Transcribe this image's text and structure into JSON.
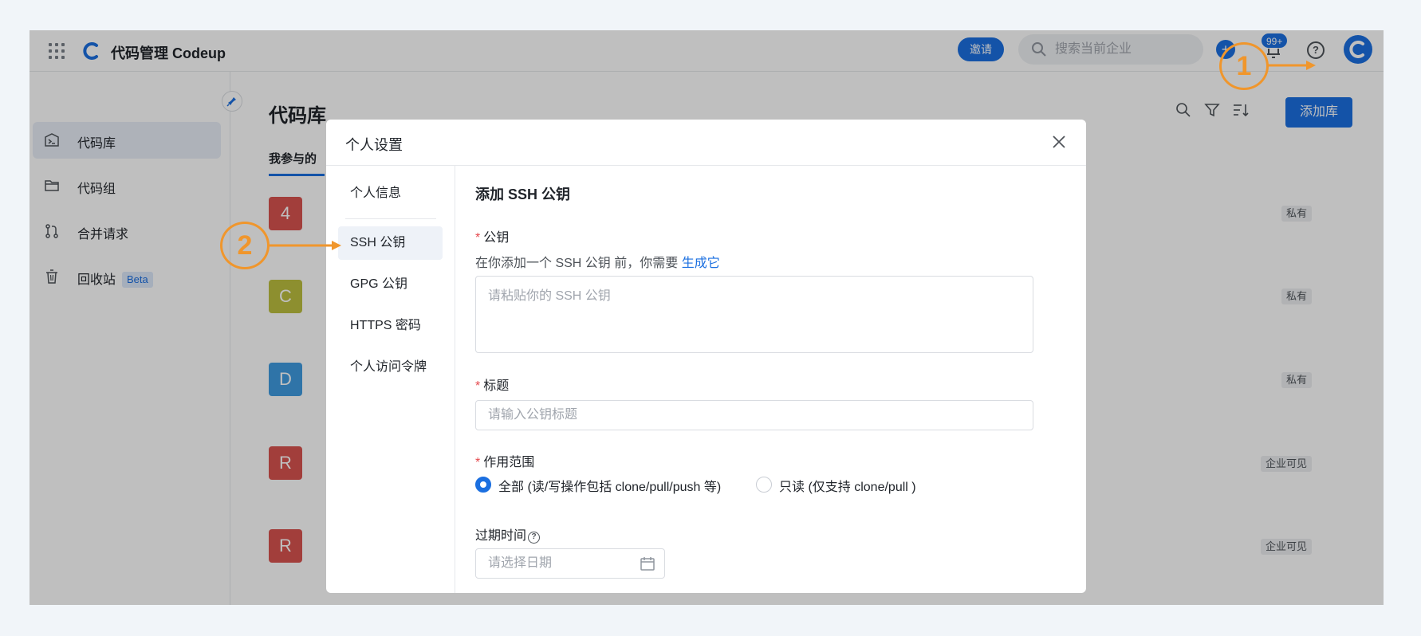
{
  "topbar": {
    "title": "代码管理 Codeup",
    "invite_label": "邀请",
    "search_placeholder": "搜索当前企业",
    "plus_label": "+",
    "notification_badge": "99+",
    "help_label": "?"
  },
  "sidebar": {
    "items": [
      {
        "label": "代码库",
        "icon": "terminal-icon"
      },
      {
        "label": "代码组",
        "icon": "folder-icon"
      },
      {
        "label": "合并请求",
        "icon": "merge-request-icon"
      },
      {
        "label": "回收站",
        "icon": "trash-icon",
        "tag": "Beta"
      }
    ]
  },
  "main": {
    "title": "代码库",
    "tab": "我参与的",
    "add_label": "添加库",
    "repos": [
      {
        "letter": "4",
        "color": "#d9534f",
        "visibility": "私有"
      },
      {
        "letter": "C",
        "color": "#bdbf3f",
        "visibility": "私有"
      },
      {
        "letter": "D",
        "color": "#3f9be0",
        "visibility": "私有"
      },
      {
        "letter": "R",
        "color": "#d9534f",
        "visibility": "企业可见"
      },
      {
        "letter": "R",
        "color": "#d9534f",
        "visibility": "企业可见"
      }
    ]
  },
  "modal": {
    "title": "个人设置",
    "nav": [
      "个人信息",
      "SSH 公钥",
      "GPG 公钥",
      "HTTPS 密码",
      "个人访问令牌"
    ],
    "section_title": "添加 SSH 公钥",
    "key_label": "公钥",
    "hint_text": "在你添加一个 SSH 公钥 前，你需要 ",
    "hint_link": "生成它",
    "key_placeholder": "请粘贴你的 SSH 公钥",
    "title_label": "标题",
    "title_placeholder": "请输入公钥标题",
    "scope_label": "作用范围",
    "scope_options": [
      "全部 (读/写操作包括 clone/pull/push 等)",
      "只读 (仅支持 clone/pull )"
    ],
    "expiry_label": "过期时间",
    "expiry_placeholder": "请选择日期",
    "required_mark": "*"
  },
  "annotations": {
    "one": "1",
    "two": "2"
  },
  "colors": {
    "accent": "#1b6fe0",
    "annotation": "#f0962c"
  }
}
